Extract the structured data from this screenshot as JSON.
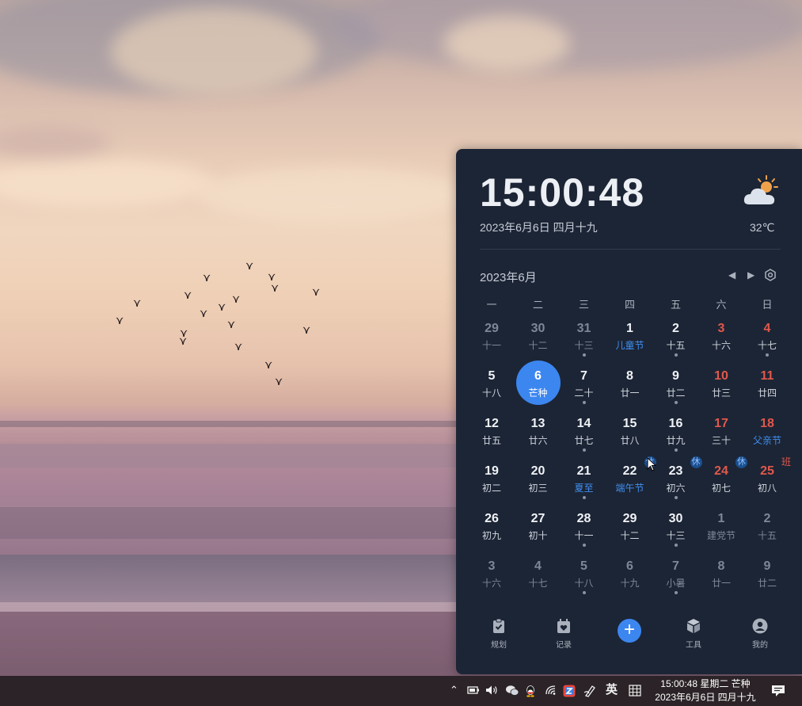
{
  "widget": {
    "time": "15:00:48",
    "date_line": "2023年6月6日 四月十九",
    "temperature": "32℃",
    "weather_icon": "partly-cloudy-sun-icon",
    "month_title": "2023年6月",
    "weekdays": [
      "一",
      "二",
      "三",
      "四",
      "五",
      "六",
      "日"
    ],
    "weeks": [
      [
        {
          "day": "29",
          "lunar": "十一",
          "other": true,
          "dot": false
        },
        {
          "day": "30",
          "lunar": "十二",
          "other": true,
          "dot": false
        },
        {
          "day": "31",
          "lunar": "十三",
          "other": true,
          "dot": true
        },
        {
          "day": "1",
          "lunar": "儿童节",
          "festival": true,
          "dot": false
        },
        {
          "day": "2",
          "lunar": "十五",
          "dot": true
        },
        {
          "day": "3",
          "lunar": "十六",
          "weekend": true,
          "dot": false
        },
        {
          "day": "4",
          "lunar": "十七",
          "weekend": true,
          "dot": true
        }
      ],
      [
        {
          "day": "5",
          "lunar": "十八",
          "dot": false
        },
        {
          "day": "6",
          "lunar": "芒种",
          "today": true,
          "dot": false
        },
        {
          "day": "7",
          "lunar": "二十",
          "dot": true
        },
        {
          "day": "8",
          "lunar": "廿一",
          "dot": false
        },
        {
          "day": "9",
          "lunar": "廿二",
          "dot": true
        },
        {
          "day": "10",
          "lunar": "廿三",
          "weekend": true,
          "dot": false
        },
        {
          "day": "11",
          "lunar": "廿四",
          "weekend": true,
          "dot": false
        }
      ],
      [
        {
          "day": "12",
          "lunar": "廿五",
          "dot": false
        },
        {
          "day": "13",
          "lunar": "廿六",
          "dot": false
        },
        {
          "day": "14",
          "lunar": "廿七",
          "dot": true
        },
        {
          "day": "15",
          "lunar": "廿八",
          "dot": false
        },
        {
          "day": "16",
          "lunar": "廿九",
          "dot": true
        },
        {
          "day": "17",
          "lunar": "三十",
          "weekend": true,
          "dot": false
        },
        {
          "day": "18",
          "lunar": "父亲节",
          "weekend": true,
          "festival": true,
          "dot": false
        }
      ],
      [
        {
          "day": "19",
          "lunar": "初二",
          "dot": false
        },
        {
          "day": "20",
          "lunar": "初三",
          "dot": false
        },
        {
          "day": "21",
          "lunar": "夏至",
          "festival": true,
          "dot": true
        },
        {
          "day": "22",
          "lunar": "端午节",
          "festival": true,
          "badge": "休",
          "badge_type": "rest",
          "dot": false
        },
        {
          "day": "23",
          "lunar": "初六",
          "badge": "休",
          "badge_type": "rest",
          "dot": true
        },
        {
          "day": "24",
          "lunar": "初七",
          "weekend": true,
          "badge": "休",
          "badge_type": "rest",
          "dot": false
        },
        {
          "day": "25",
          "lunar": "初八",
          "weekend": true,
          "badge": "班",
          "badge_type": "work",
          "dot": false
        }
      ],
      [
        {
          "day": "26",
          "lunar": "初九",
          "dot": false
        },
        {
          "day": "27",
          "lunar": "初十",
          "dot": false
        },
        {
          "day": "28",
          "lunar": "十一",
          "dot": true
        },
        {
          "day": "29",
          "lunar": "十二",
          "dot": false
        },
        {
          "day": "30",
          "lunar": "十三",
          "dot": true
        },
        {
          "day": "1",
          "lunar": "建党节",
          "other": true,
          "dot": false
        },
        {
          "day": "2",
          "lunar": "十五",
          "other": true,
          "dot": false
        }
      ],
      [
        {
          "day": "3",
          "lunar": "十六",
          "other": true,
          "dot": false
        },
        {
          "day": "4",
          "lunar": "十七",
          "other": true,
          "dot": false
        },
        {
          "day": "5",
          "lunar": "十八",
          "other": true,
          "dot": true
        },
        {
          "day": "6",
          "lunar": "十九",
          "other": true,
          "dot": false
        },
        {
          "day": "7",
          "lunar": "小暑",
          "other": true,
          "dot": true
        },
        {
          "day": "8",
          "lunar": "廿一",
          "other": true,
          "dot": false
        },
        {
          "day": "9",
          "lunar": "廿二",
          "other": true,
          "dot": false
        }
      ]
    ],
    "bottom_nav": {
      "plan": "规划",
      "record": "记录",
      "add": "+",
      "tools": "工具",
      "mine": "我的"
    }
  },
  "taskbar": {
    "time_line": "15:00:48 星期二 芒种",
    "date_line": "2023年6月6日 四月十九",
    "ime_label": "英",
    "tray": [
      "chevron-up-icon",
      "battery-icon",
      "volume-icon",
      "wechat-icon",
      "qq-icon",
      "app-icon",
      "wifi-icon",
      "pen-icon",
      "ime-icon",
      "keyboard-grid-icon",
      "notification-icon"
    ]
  }
}
